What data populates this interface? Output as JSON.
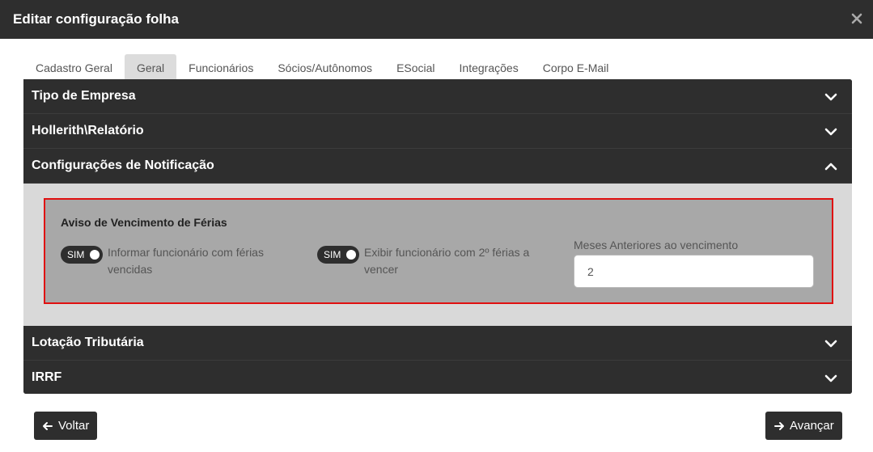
{
  "dialog": {
    "title": "Editar configuração folha",
    "close_icon": "close-icon"
  },
  "tabs": [
    {
      "label": "Cadastro Geral",
      "active": false
    },
    {
      "label": "Geral",
      "active": true
    },
    {
      "label": "Funcionários",
      "active": false
    },
    {
      "label": "Sócios/Autônomos",
      "active": false
    },
    {
      "label": "ESocial",
      "active": false
    },
    {
      "label": "Integrações",
      "active": false
    },
    {
      "label": "Corpo E-Mail",
      "active": false
    }
  ],
  "sections": {
    "tipo_empresa": {
      "label": "Tipo de Empresa",
      "expanded": false,
      "icon": "chevron-down-icon"
    },
    "hollerith": {
      "label": "Hollerith\\Relatório",
      "expanded": false,
      "icon": "chevron-down-icon"
    },
    "notificacao": {
      "label": "Configurações de Notificação",
      "expanded": true,
      "icon": "chevron-up-icon"
    },
    "lotacao": {
      "label": "Lotação Tributária",
      "expanded": false,
      "icon": "chevron-down-icon"
    },
    "irrf": {
      "label": "IRRF",
      "expanded": false,
      "icon": "chevron-down-icon"
    }
  },
  "notification": {
    "title": "Aviso de Vencimento de Férias",
    "toggle1": {
      "state": "SIM",
      "label": "Informar funcionário com férias vencidas"
    },
    "toggle2": {
      "state": "SIM",
      "label": "Exibir funcionário com 2º férias a vencer"
    },
    "months_field": {
      "label": "Meses Anteriores ao vencimento",
      "value": "2"
    }
  },
  "footer": {
    "back_label": "Voltar",
    "next_label": "Avançar"
  },
  "colors": {
    "dark": "#2e2e2e",
    "highlight_border": "#e01010",
    "panel_bg": "#d9d9d9",
    "box_bg": "#a8a8a8"
  }
}
